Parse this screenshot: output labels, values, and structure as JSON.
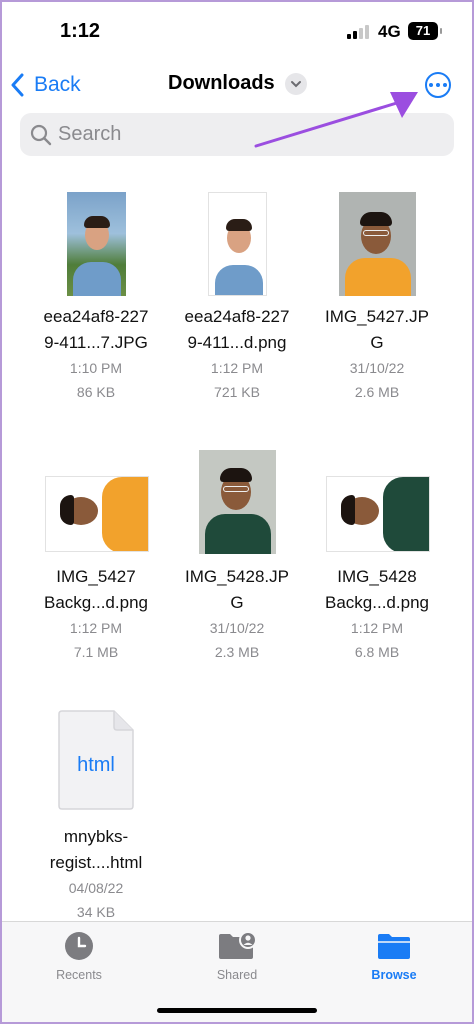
{
  "status_bar": {
    "time": "1:12",
    "network": "4G",
    "battery": "71"
  },
  "nav": {
    "back_label": "Back",
    "title": "Downloads"
  },
  "search": {
    "placeholder": "Search"
  },
  "files": [
    {
      "name_line1": "eea24af8-227",
      "name_line2": "9-411...7.JPG",
      "time": "1:10 PM",
      "size": "86 KB"
    },
    {
      "name_line1": "eea24af8-227",
      "name_line2": "9-411...d.png",
      "time": "1:12 PM",
      "size": "721 KB"
    },
    {
      "name_line1": "IMG_5427.JP",
      "name_line2": "G",
      "time": "31/10/22",
      "size": "2.6 MB"
    },
    {
      "name_line1": "IMG_5427",
      "name_line2": "Backg...d.png",
      "time": "1:12 PM",
      "size": "7.1 MB"
    },
    {
      "name_line1": "IMG_5428.JP",
      "name_line2": "G",
      "time": "31/10/22",
      "size": "2.3 MB"
    },
    {
      "name_line1": "IMG_5428",
      "name_line2": "Backg...d.png",
      "time": "1:12 PM",
      "size": "6.8 MB"
    },
    {
      "name_line1": "mnybks-",
      "name_line2": "regist....html",
      "time": "04/08/22",
      "size": "34 KB",
      "icon_text": "html"
    }
  ],
  "tabs": [
    {
      "label": "Recents",
      "icon": "clock-icon"
    },
    {
      "label": "Shared",
      "icon": "shared-folder-icon"
    },
    {
      "label": "Browse",
      "icon": "folder-icon",
      "active": true
    }
  ],
  "colors": {
    "accent": "#1a7cf5",
    "annotation_arrow": "#9b4ee0",
    "secondary_text": "#8a8a8e"
  }
}
